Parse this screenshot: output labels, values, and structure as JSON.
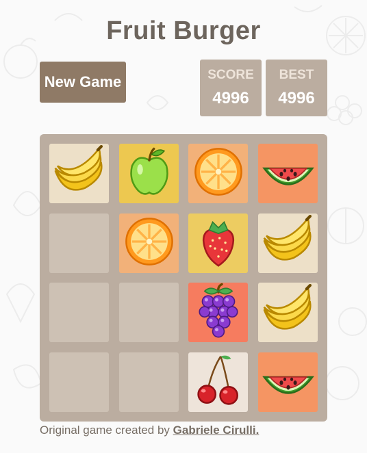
{
  "game": {
    "title": "Fruit Burger"
  },
  "controls": {
    "new_game_label": "New Game"
  },
  "score": {
    "label": "SCORE",
    "value": "4996"
  },
  "best": {
    "label": "BEST",
    "value": "4996"
  },
  "board": {
    "rows": 4,
    "cols": 4,
    "tiles": [
      [
        "banana",
        "apple",
        "orange",
        "watermelon"
      ],
      [
        "empty",
        "orange",
        "strawberry",
        "banana"
      ],
      [
        "empty",
        "empty",
        "grapes",
        "banana"
      ],
      [
        "empty",
        "empty",
        "cherry",
        "watermelon"
      ]
    ]
  },
  "footer": {
    "text": "Original game created by ",
    "author": "Gabriele Cirulli."
  },
  "colors": {
    "banana": "#ede0c8",
    "apple": "#edc850",
    "orange": "#f2b179",
    "watermelon": "#f59563",
    "strawberry": "#edcc61",
    "grapes": "#f67c5f",
    "cherry": "#eee4da",
    "empty": "#cdc1b4"
  }
}
